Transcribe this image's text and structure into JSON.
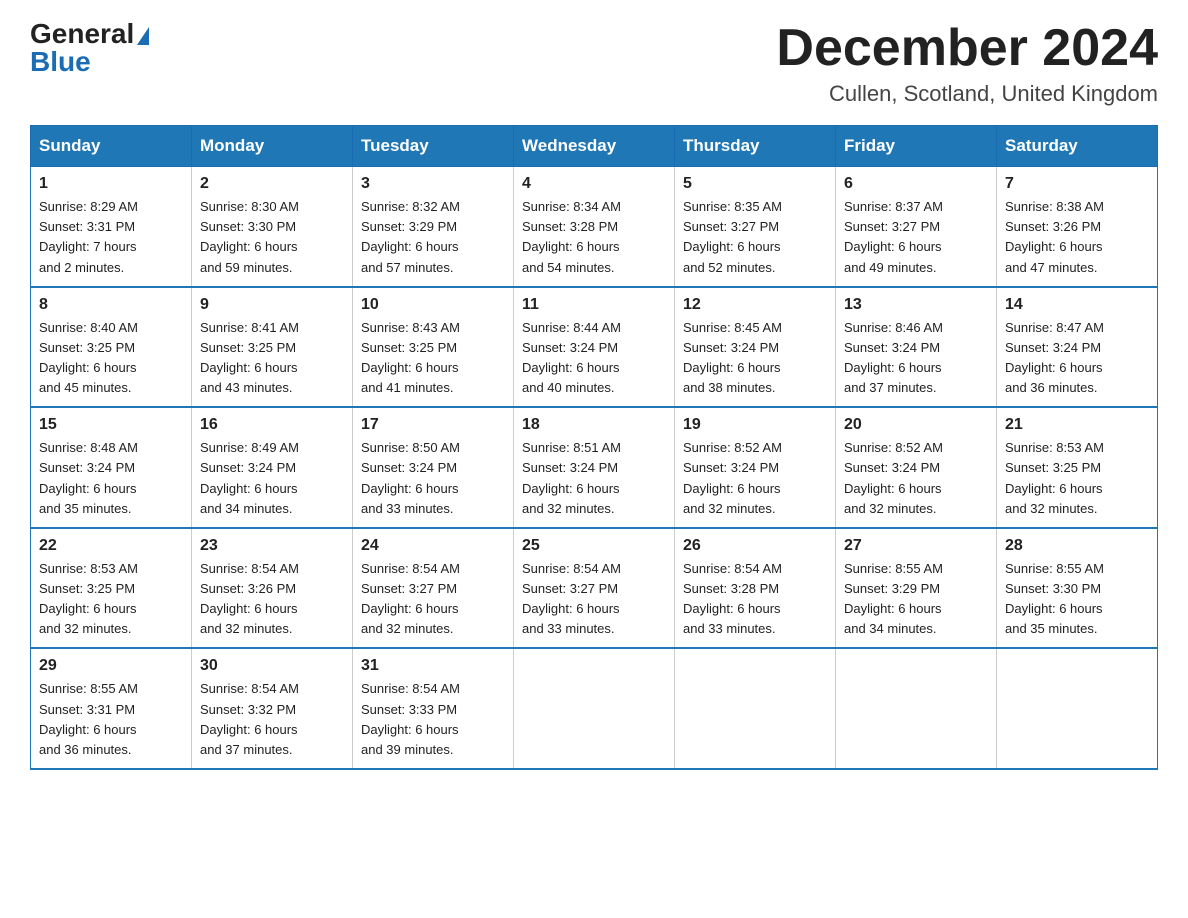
{
  "header": {
    "logo_general": "General",
    "logo_blue": "Blue",
    "month_title": "December 2024",
    "location": "Cullen, Scotland, United Kingdom"
  },
  "weekdays": [
    "Sunday",
    "Monday",
    "Tuesday",
    "Wednesday",
    "Thursday",
    "Friday",
    "Saturday"
  ],
  "weeks": [
    [
      {
        "day": "1",
        "info": "Sunrise: 8:29 AM\nSunset: 3:31 PM\nDaylight: 7 hours\nand 2 minutes."
      },
      {
        "day": "2",
        "info": "Sunrise: 8:30 AM\nSunset: 3:30 PM\nDaylight: 6 hours\nand 59 minutes."
      },
      {
        "day": "3",
        "info": "Sunrise: 8:32 AM\nSunset: 3:29 PM\nDaylight: 6 hours\nand 57 minutes."
      },
      {
        "day": "4",
        "info": "Sunrise: 8:34 AM\nSunset: 3:28 PM\nDaylight: 6 hours\nand 54 minutes."
      },
      {
        "day": "5",
        "info": "Sunrise: 8:35 AM\nSunset: 3:27 PM\nDaylight: 6 hours\nand 52 minutes."
      },
      {
        "day": "6",
        "info": "Sunrise: 8:37 AM\nSunset: 3:27 PM\nDaylight: 6 hours\nand 49 minutes."
      },
      {
        "day": "7",
        "info": "Sunrise: 8:38 AM\nSunset: 3:26 PM\nDaylight: 6 hours\nand 47 minutes."
      }
    ],
    [
      {
        "day": "8",
        "info": "Sunrise: 8:40 AM\nSunset: 3:25 PM\nDaylight: 6 hours\nand 45 minutes."
      },
      {
        "day": "9",
        "info": "Sunrise: 8:41 AM\nSunset: 3:25 PM\nDaylight: 6 hours\nand 43 minutes."
      },
      {
        "day": "10",
        "info": "Sunrise: 8:43 AM\nSunset: 3:25 PM\nDaylight: 6 hours\nand 41 minutes."
      },
      {
        "day": "11",
        "info": "Sunrise: 8:44 AM\nSunset: 3:24 PM\nDaylight: 6 hours\nand 40 minutes."
      },
      {
        "day": "12",
        "info": "Sunrise: 8:45 AM\nSunset: 3:24 PM\nDaylight: 6 hours\nand 38 minutes."
      },
      {
        "day": "13",
        "info": "Sunrise: 8:46 AM\nSunset: 3:24 PM\nDaylight: 6 hours\nand 37 minutes."
      },
      {
        "day": "14",
        "info": "Sunrise: 8:47 AM\nSunset: 3:24 PM\nDaylight: 6 hours\nand 36 minutes."
      }
    ],
    [
      {
        "day": "15",
        "info": "Sunrise: 8:48 AM\nSunset: 3:24 PM\nDaylight: 6 hours\nand 35 minutes."
      },
      {
        "day": "16",
        "info": "Sunrise: 8:49 AM\nSunset: 3:24 PM\nDaylight: 6 hours\nand 34 minutes."
      },
      {
        "day": "17",
        "info": "Sunrise: 8:50 AM\nSunset: 3:24 PM\nDaylight: 6 hours\nand 33 minutes."
      },
      {
        "day": "18",
        "info": "Sunrise: 8:51 AM\nSunset: 3:24 PM\nDaylight: 6 hours\nand 32 minutes."
      },
      {
        "day": "19",
        "info": "Sunrise: 8:52 AM\nSunset: 3:24 PM\nDaylight: 6 hours\nand 32 minutes."
      },
      {
        "day": "20",
        "info": "Sunrise: 8:52 AM\nSunset: 3:24 PM\nDaylight: 6 hours\nand 32 minutes."
      },
      {
        "day": "21",
        "info": "Sunrise: 8:53 AM\nSunset: 3:25 PM\nDaylight: 6 hours\nand 32 minutes."
      }
    ],
    [
      {
        "day": "22",
        "info": "Sunrise: 8:53 AM\nSunset: 3:25 PM\nDaylight: 6 hours\nand 32 minutes."
      },
      {
        "day": "23",
        "info": "Sunrise: 8:54 AM\nSunset: 3:26 PM\nDaylight: 6 hours\nand 32 minutes."
      },
      {
        "day": "24",
        "info": "Sunrise: 8:54 AM\nSunset: 3:27 PM\nDaylight: 6 hours\nand 32 minutes."
      },
      {
        "day": "25",
        "info": "Sunrise: 8:54 AM\nSunset: 3:27 PM\nDaylight: 6 hours\nand 33 minutes."
      },
      {
        "day": "26",
        "info": "Sunrise: 8:54 AM\nSunset: 3:28 PM\nDaylight: 6 hours\nand 33 minutes."
      },
      {
        "day": "27",
        "info": "Sunrise: 8:55 AM\nSunset: 3:29 PM\nDaylight: 6 hours\nand 34 minutes."
      },
      {
        "day": "28",
        "info": "Sunrise: 8:55 AM\nSunset: 3:30 PM\nDaylight: 6 hours\nand 35 minutes."
      }
    ],
    [
      {
        "day": "29",
        "info": "Sunrise: 8:55 AM\nSunset: 3:31 PM\nDaylight: 6 hours\nand 36 minutes."
      },
      {
        "day": "30",
        "info": "Sunrise: 8:54 AM\nSunset: 3:32 PM\nDaylight: 6 hours\nand 37 minutes."
      },
      {
        "day": "31",
        "info": "Sunrise: 8:54 AM\nSunset: 3:33 PM\nDaylight: 6 hours\nand 39 minutes."
      },
      {
        "day": "",
        "info": ""
      },
      {
        "day": "",
        "info": ""
      },
      {
        "day": "",
        "info": ""
      },
      {
        "day": "",
        "info": ""
      }
    ]
  ]
}
